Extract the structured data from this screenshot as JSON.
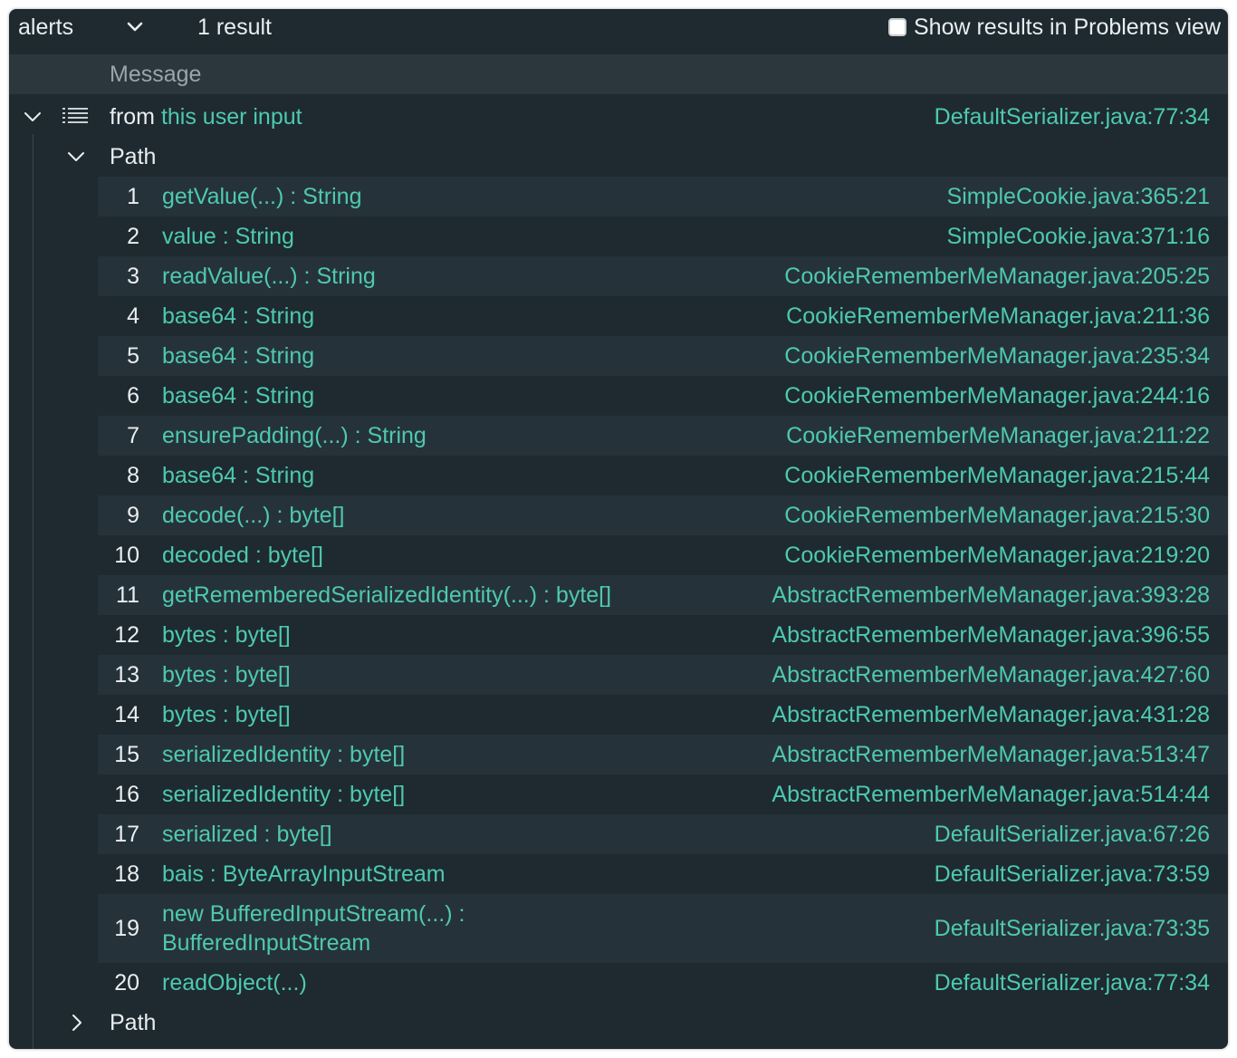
{
  "toolbar": {
    "selector_value": "alerts",
    "result_count": "1 result",
    "problems_checkbox_label": "Show results in Problems view"
  },
  "header": {
    "message_col": "Message"
  },
  "alert": {
    "prefix": "from",
    "link_text": "this user input",
    "location": "DefaultSerializer.java:77:34"
  },
  "path_label": "Path",
  "path_label_2": "Path",
  "steps": [
    {
      "n": "1",
      "text": "getValue(...) : String",
      "loc": "SimpleCookie.java:365:21"
    },
    {
      "n": "2",
      "text": "value : String",
      "loc": "SimpleCookie.java:371:16"
    },
    {
      "n": "3",
      "text": "readValue(...) : String",
      "loc": "CookieRememberMeManager.java:205:25"
    },
    {
      "n": "4",
      "text": "base64 : String",
      "loc": "CookieRememberMeManager.java:211:36"
    },
    {
      "n": "5",
      "text": "base64 : String",
      "loc": "CookieRememberMeManager.java:235:34"
    },
    {
      "n": "6",
      "text": "base64 : String",
      "loc": "CookieRememberMeManager.java:244:16"
    },
    {
      "n": "7",
      "text": "ensurePadding(...) : String",
      "loc": "CookieRememberMeManager.java:211:22"
    },
    {
      "n": "8",
      "text": "base64 : String",
      "loc": "CookieRememberMeManager.java:215:44"
    },
    {
      "n": "9",
      "text": "decode(...) : byte[]",
      "loc": "CookieRememberMeManager.java:215:30"
    },
    {
      "n": "10",
      "text": "decoded : byte[]",
      "loc": "CookieRememberMeManager.java:219:20"
    },
    {
      "n": "11",
      "text": "getRememberedSerializedIdentity(...) : byte[]",
      "loc": "AbstractRememberMeManager.java:393:28"
    },
    {
      "n": "12",
      "text": "bytes : byte[]",
      "loc": "AbstractRememberMeManager.java:396:55"
    },
    {
      "n": "13",
      "text": "bytes : byte[]",
      "loc": "AbstractRememberMeManager.java:427:60"
    },
    {
      "n": "14",
      "text": "bytes : byte[]",
      "loc": "AbstractRememberMeManager.java:431:28"
    },
    {
      "n": "15",
      "text": "serializedIdentity : byte[]",
      "loc": "AbstractRememberMeManager.java:513:47"
    },
    {
      "n": "16",
      "text": "serializedIdentity : byte[]",
      "loc": "AbstractRememberMeManager.java:514:44"
    },
    {
      "n": "17",
      "text": "serialized : byte[]",
      "loc": "DefaultSerializer.java:67:26"
    },
    {
      "n": "18",
      "text": "bais : ByteArrayInputStream",
      "loc": "DefaultSerializer.java:73:59"
    },
    {
      "n": "19",
      "text": "new BufferedInputStream(...) : BufferedInputStream",
      "loc": "DefaultSerializer.java:73:35"
    },
    {
      "n": "20",
      "text": "readObject(...)",
      "loc": "DefaultSerializer.java:77:34"
    }
  ],
  "colors": {
    "panel_bg": "#1e2a30",
    "link": "#4ec9b0",
    "row_alt": "#26323a"
  }
}
